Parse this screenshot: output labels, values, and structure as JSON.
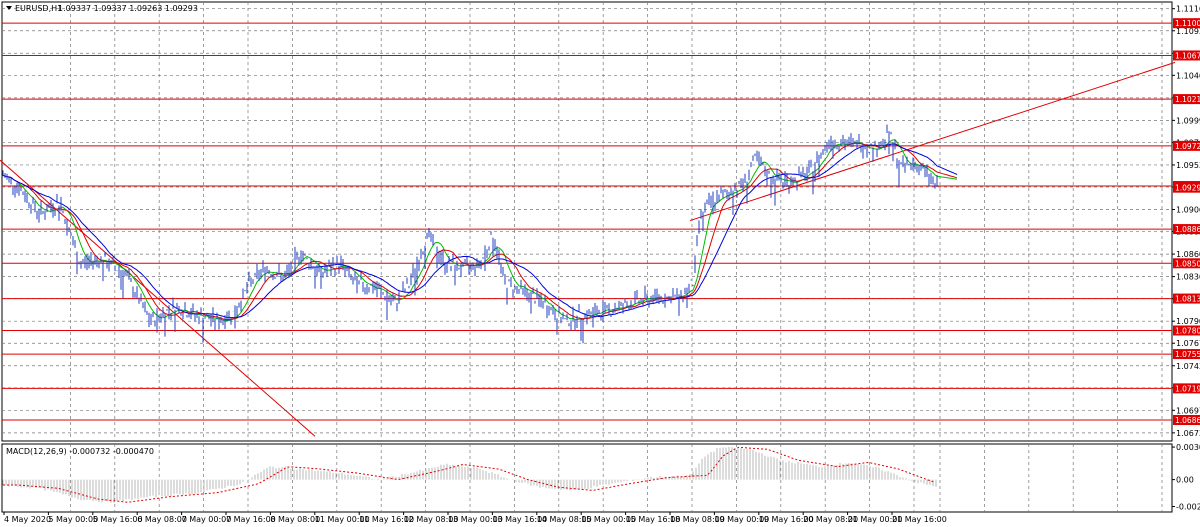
{
  "chart_data": {
    "type": "candlestick",
    "header": {
      "symbol": "EURUSD,H1",
      "ohlc": "1.09337 1.09337 1.09263 1.09293"
    },
    "price_axis": {
      "ticks": [
        "1.11160",
        "1.10930",
        "1.10695",
        "1.10465",
        "1.10230",
        "1.09995",
        "1.09765",
        "1.09530",
        "1.09300",
        "1.09065",
        "1.08835",
        "1.08600",
        "1.08365",
        "1.08135",
        "1.07900",
        "1.07670",
        "1.07435",
        "1.07205",
        "1.06970",
        "1.06735"
      ],
      "range": [
        1.0665,
        1.1123
      ]
    },
    "levels": [
      "1.11009",
      "1.10672",
      "1.10217",
      "1.09729",
      "1.09310",
      "1.08861",
      "1.08504",
      "1.08136",
      "1.07803",
      "1.07557",
      "1.07199",
      "1.06869"
    ],
    "time_axis": [
      "4 May 2020",
      "5 May 00:00",
      "5 May 16:00",
      "6 May 08:00",
      "7 May 00:00",
      "7 May 16:00",
      "8 May 08:00",
      "11 May 00:00",
      "11 May 16:00",
      "12 May 08:00",
      "13 May 00:00",
      "13 May 16:00",
      "14 May 08:00",
      "15 May 00:00",
      "15 May 16:00",
      "18 May 08:00",
      "19 May 00:00",
      "19 May 16:00",
      "20 May 08:00",
      "21 May 00:00",
      "21 May 16:00"
    ],
    "price_path": [
      [
        0,
        1.0945
      ],
      [
        20,
        1.0928
      ],
      [
        40,
        1.0902
      ],
      [
        60,
        1.0915
      ],
      [
        80,
        1.085
      ],
      [
        100,
        1.0855
      ],
      [
        125,
        1.084
      ],
      [
        150,
        1.079
      ],
      [
        175,
        1.0805
      ],
      [
        200,
        1.0795
      ],
      [
        220,
        1.079
      ],
      [
        235,
        1.08
      ],
      [
        250,
        1.083
      ],
      [
        265,
        1.0845
      ],
      [
        285,
        1.0835
      ],
      [
        300,
        1.0862
      ],
      [
        320,
        1.084
      ],
      [
        340,
        1.085
      ],
      [
        355,
        1.083
      ],
      [
        375,
        1.0825
      ],
      [
        395,
        1.0808
      ],
      [
        410,
        1.083
      ],
      [
        428,
        1.088
      ],
      [
        445,
        1.085
      ],
      [
        465,
        1.0845
      ],
      [
        480,
        1.085
      ],
      [
        493,
        1.088
      ],
      [
        505,
        1.083
      ],
      [
        525,
        1.082
      ],
      [
        545,
        1.0808
      ],
      [
        565,
        1.079
      ],
      [
        580,
        1.0795
      ],
      [
        600,
        1.08
      ],
      [
        620,
        1.0805
      ],
      [
        640,
        1.0812
      ],
      [
        660,
        1.0815
      ],
      [
        680,
        1.0815
      ],
      [
        693,
        1.083
      ],
      [
        700,
        1.09
      ],
      [
        712,
        1.0915
      ],
      [
        730,
        1.0925
      ],
      [
        745,
        1.0935
      ],
      [
        755,
        1.096
      ],
      [
        770,
        1.094
      ],
      [
        790,
        1.0935
      ],
      [
        810,
        1.0945
      ],
      [
        830,
        1.098
      ],
      [
        845,
        1.0975
      ],
      [
        860,
        1.0975
      ],
      [
        875,
        1.097
      ],
      [
        890,
        1.0985
      ],
      [
        900,
        1.095
      ],
      [
        915,
        1.0955
      ],
      [
        930,
        1.094
      ],
      [
        937,
        1.093
      ]
    ],
    "trendlines": [
      {
        "from": [
          0,
          1.0958
        ],
        "to": [
          315,
          1.067
        ]
      },
      {
        "from": [
          690,
          1.0895
        ],
        "to": [
          1175,
          1.106
        ]
      }
    ],
    "moving_averages": [
      {
        "color": "#00bb00",
        "period": "fast"
      },
      {
        "color": "#e00000",
        "period": "medium"
      },
      {
        "color": "#0000dd",
        "period": "slow"
      }
    ],
    "macd": {
      "label": "MACD(12,26,9) -0.000732 -0.000470",
      "ticks": [
        "0.003016",
        "0.00",
        "-0.002490"
      ],
      "range": [
        -0.003,
        0.0033
      ],
      "hist_path": [
        [
          0,
          -0.0005
        ],
        [
          40,
          -0.0008
        ],
        [
          80,
          -0.0018
        ],
        [
          110,
          -0.0021
        ],
        [
          150,
          -0.0016
        ],
        [
          200,
          -0.0012
        ],
        [
          240,
          -0.0004
        ],
        [
          270,
          0.0012
        ],
        [
          300,
          0.001
        ],
        [
          340,
          0.0006
        ],
        [
          380,
          0.0
        ],
        [
          420,
          0.0008
        ],
        [
          445,
          0.0014
        ],
        [
          480,
          0.001
        ],
        [
          510,
          0.0
        ],
        [
          540,
          -0.0007
        ],
        [
          575,
          -0.001
        ],
        [
          610,
          -0.0004
        ],
        [
          650,
          0.0002
        ],
        [
          690,
          0.0004
        ],
        [
          705,
          0.0022
        ],
        [
          720,
          0.003
        ],
        [
          750,
          0.0028
        ],
        [
          780,
          0.0018
        ],
        [
          820,
          0.0012
        ],
        [
          850,
          0.0016
        ],
        [
          880,
          0.001
        ],
        [
          915,
          -0.0002
        ],
        [
          937,
          -0.0007
        ]
      ]
    },
    "current_price": "1.09293"
  }
}
